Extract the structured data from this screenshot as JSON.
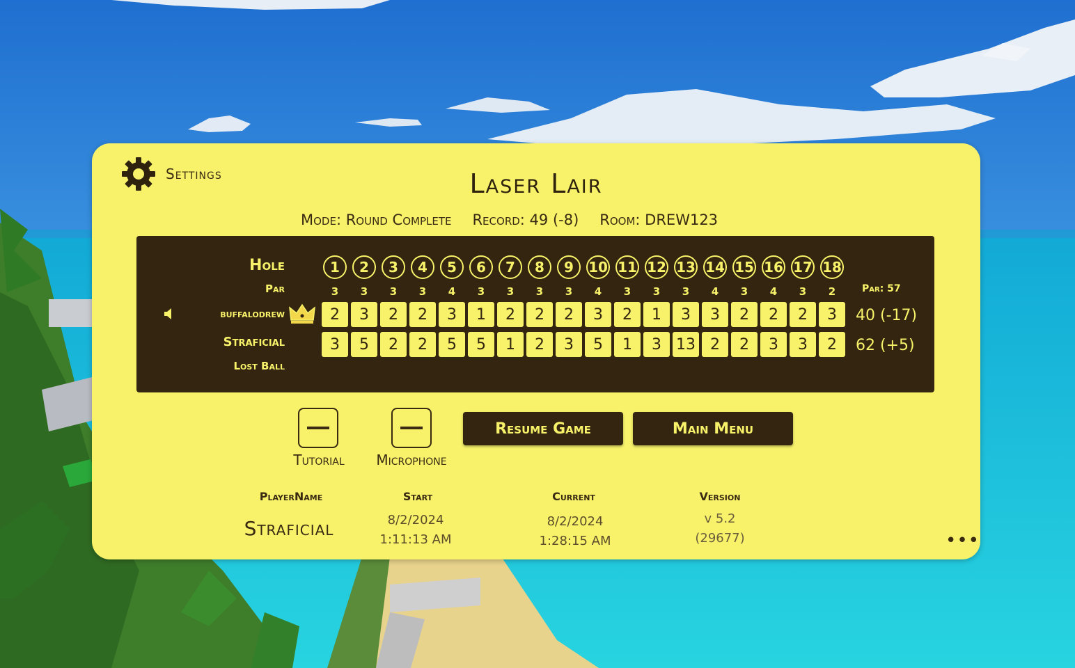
{
  "settings": {
    "label": "Settings"
  },
  "course": {
    "title": "Laser Lair"
  },
  "info": {
    "mode": "Mode: Round Complete",
    "record": "Record: 49 (-8)",
    "room": "Room: DREW123"
  },
  "scoreboard": {
    "hole_label": "Hole",
    "par_label": "Par",
    "holes": [
      "1",
      "2",
      "3",
      "4",
      "5",
      "6",
      "7",
      "8",
      "9",
      "10",
      "11",
      "12",
      "13",
      "14",
      "15",
      "16",
      "17",
      "18"
    ],
    "pars": [
      "3",
      "3",
      "3",
      "3",
      "4",
      "3",
      "3",
      "3",
      "3",
      "4",
      "3",
      "3",
      "3",
      "4",
      "3",
      "4",
      "3",
      "2"
    ],
    "par_total": "Par: 57",
    "players": [
      {
        "name": "buffalodrew",
        "scores": [
          "2",
          "3",
          "2",
          "2",
          "3",
          "1",
          "2",
          "2",
          "2",
          "3",
          "2",
          "1",
          "3",
          "3",
          "2",
          "2",
          "2",
          "3"
        ],
        "total": "40 (-17)",
        "leader": true
      },
      {
        "name": "Straficial",
        "scores": [
          "3",
          "5",
          "2",
          "2",
          "5",
          "5",
          "1",
          "2",
          "3",
          "5",
          "1",
          "3",
          "13",
          "2",
          "2",
          "3",
          "3",
          "2"
        ],
        "total": "62 (+5)",
        "status": "Lost Ball"
      }
    ]
  },
  "controls": {
    "tutorial_label": "Tutorial",
    "microphone_label": "Microphone",
    "resume_label": "Resume Game",
    "main_menu_label": "Main Menu"
  },
  "footer": {
    "player_name_header": "PlayerName",
    "start_header": "Start",
    "current_header": "Current",
    "version_header": "Version",
    "player_name": "Straficial",
    "start_date": "8/2/2024",
    "start_time": "1:11:13 AM",
    "current_date": "8/2/2024",
    "current_time": "1:28:15 AM",
    "version": "v 5.2",
    "build": "(29677)",
    "more_label": "•••"
  },
  "colors": {
    "panel": "#f7f26a",
    "board": "#33250f",
    "text_dark": "#3a2a12",
    "sky": "#3b9ae0",
    "ocean": "#1cc2d8"
  },
  "icons": {
    "settings": "gear-icon",
    "leader": "crown-icon",
    "voice": "speaker-icon",
    "more": "more-dots-icon"
  }
}
